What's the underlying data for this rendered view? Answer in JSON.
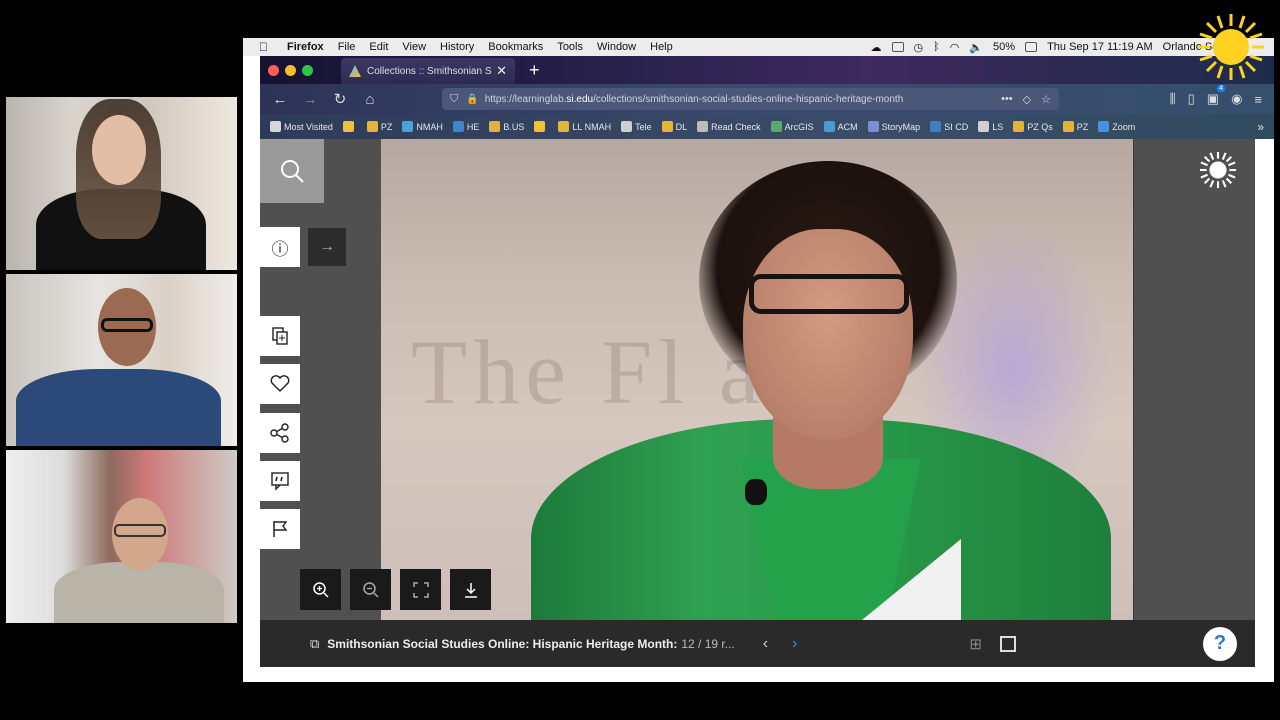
{
  "menubar": {
    "app": "Firefox",
    "items": [
      "File",
      "Edit",
      "View",
      "History",
      "Bookmarks",
      "Tools",
      "Window",
      "Help"
    ],
    "battery": "50%",
    "datetime": "Thu Sep 17  11:19 AM",
    "user": "Orlando Serrano"
  },
  "tab": {
    "label": "Collections :: Smithsonian Soci",
    "close": "✕",
    "new": "+"
  },
  "navbar": {
    "url_prefix": "https://learninglab.",
    "url_domain": "si.edu",
    "url_path": "/collections/smithsonian-social-studies-online-hispanic-heritage-month",
    "extension_badge": "4"
  },
  "bookmarks": {
    "items": [
      {
        "label": "Most Visited",
        "color": "#d6d6d6"
      },
      {
        "label": "",
        "color": "#f0c040"
      },
      {
        "label": "PZ",
        "color": "#e2b63a"
      },
      {
        "label": "NMAH",
        "color": "#4aa3d8"
      },
      {
        "label": "HE",
        "color": "#3f86c9"
      },
      {
        "label": "B.US",
        "color": "#e0b33c"
      },
      {
        "label": "",
        "color": "#f1c232"
      },
      {
        "label": "LL NMAH",
        "color": "#e1b43b"
      },
      {
        "label": "Tele",
        "color": "#cfcfcf"
      },
      {
        "label": "DL",
        "color": "#e4b53a"
      },
      {
        "label": "Read Check",
        "color": "#bcbcbc"
      },
      {
        "label": "ArcGIS",
        "color": "#5aa870"
      },
      {
        "label": "ACM",
        "color": "#4a9bd0"
      },
      {
        "label": "StoryMap",
        "color": "#7c8fd0"
      },
      {
        "label": "SI CD",
        "color": "#3e7fc0"
      },
      {
        "label": "LS",
        "color": "#d0d0d0"
      },
      {
        "label": "PZ Qs",
        "color": "#e3b43a"
      },
      {
        "label": "PZ",
        "color": "#e3b43a"
      },
      {
        "label": "Zoom",
        "color": "#4a90e2"
      }
    ],
    "more": "»"
  },
  "viewer": {
    "info_icon": "ⓘ",
    "arrow": "→",
    "collection_title": "Smithsonian Social Studies Online: Hispanic Heritage Month:",
    "position": "12 / 19 r...",
    "prev": "‹",
    "next": "›",
    "help": "?"
  }
}
